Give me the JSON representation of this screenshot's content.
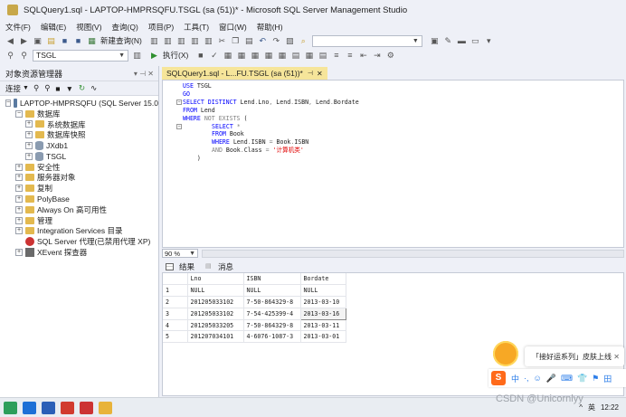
{
  "window": {
    "title": "SQLQuery1.sql - LAPTOP-HMPRSQFU.TSGL (sa (51))* - Microsoft SQL Server Management Studio"
  },
  "menu": [
    "文件(F)",
    "编辑(E)",
    "视图(V)",
    "查询(Q)",
    "项目(P)",
    "工具(T)",
    "窗口(W)",
    "帮助(H)"
  ],
  "toolbar": {
    "new_query": "新建查询(N)",
    "execute": "执行(X)",
    "database": "TSGL",
    "search_value": ""
  },
  "object_explorer": {
    "title": "对象资源管理器",
    "connect": "连接",
    "nodes": [
      {
        "label": "LAPTOP-HMPRSQFU (SQL Server 15.0",
        "depth": 0,
        "expand": "−",
        "icon": "server-icon"
      },
      {
        "label": "数据库",
        "depth": 1,
        "expand": "−",
        "icon": "folder-icon"
      },
      {
        "label": "系统数据库",
        "depth": 2,
        "expand": "+",
        "icon": "folder-icon"
      },
      {
        "label": "数据库快照",
        "depth": 2,
        "expand": "+",
        "icon": "folder-icon"
      },
      {
        "label": "JXdb1",
        "depth": 2,
        "expand": "+",
        "icon": "database-icon"
      },
      {
        "label": "TSGL",
        "depth": 2,
        "expand": "+",
        "icon": "database-icon"
      },
      {
        "label": "安全性",
        "depth": 1,
        "expand": "+",
        "icon": "folder-icon"
      },
      {
        "label": "服务器对象",
        "depth": 1,
        "expand": "+",
        "icon": "folder-icon"
      },
      {
        "label": "复制",
        "depth": 1,
        "expand": "+",
        "icon": "folder-icon"
      },
      {
        "label": "PolyBase",
        "depth": 1,
        "expand": "+",
        "icon": "folder-icon"
      },
      {
        "label": "Always On 高可用性",
        "depth": 1,
        "expand": "+",
        "icon": "folder-icon"
      },
      {
        "label": "管理",
        "depth": 1,
        "expand": "+",
        "icon": "folder-icon"
      },
      {
        "label": "Integration Services 目录",
        "depth": 1,
        "expand": "+",
        "icon": "folder-icon"
      },
      {
        "label": "SQL Server 代理(已禁用代理 XP)",
        "depth": 1,
        "expand": "",
        "icon": "agent-icon"
      },
      {
        "label": "XEvent 探查器",
        "depth": 1,
        "expand": "+",
        "icon": "xevent-icon"
      }
    ]
  },
  "editor": {
    "tab_label": "SQLQuery1.sql - L...FU.TSGL (sa (51))*",
    "zoom": "90 %",
    "lines": [
      {
        "indent": 0,
        "parts": [
          [
            "kw",
            "USE "
          ],
          [
            "blk",
            "TSGL"
          ]
        ]
      },
      {
        "indent": 0,
        "parts": [
          [
            "kw",
            "GO"
          ]
        ]
      },
      {
        "indent": 0,
        "parts": [
          [
            "kw",
            "SELECT DISTINCT "
          ],
          [
            "blk",
            "Lend"
          ],
          [
            "gray",
            "."
          ],
          [
            "blk",
            "Lno"
          ],
          [
            "gray",
            ","
          ],
          [
            "blk",
            " Lend"
          ],
          [
            "gray",
            "."
          ],
          [
            "blk",
            "ISBN"
          ],
          [
            "gray",
            ","
          ],
          [
            "blk",
            " Lend"
          ],
          [
            "gray",
            "."
          ],
          [
            "blk",
            "Bordate"
          ]
        ]
      },
      {
        "indent": 0,
        "parts": [
          [
            "kw",
            "FROM "
          ],
          [
            "blk",
            "Lend"
          ]
        ]
      },
      {
        "indent": 0,
        "parts": [
          [
            "kw",
            "WHERE "
          ],
          [
            "gray",
            "NOT EXISTS "
          ],
          [
            "blk",
            "("
          ]
        ]
      },
      {
        "indent": 1,
        "parts": [
          [
            "kw",
            "SELECT "
          ],
          [
            "gray",
            "*"
          ]
        ]
      },
      {
        "indent": 1,
        "parts": [
          [
            "kw",
            "FROM "
          ],
          [
            "blk",
            "Book"
          ]
        ]
      },
      {
        "indent": 1,
        "parts": [
          [
            "kw",
            "WHERE "
          ],
          [
            "blk",
            "Lend"
          ],
          [
            "gray",
            "."
          ],
          [
            "blk",
            "ISBN "
          ],
          [
            "gray",
            "= "
          ],
          [
            "blk",
            "Book"
          ],
          [
            "gray",
            "."
          ],
          [
            "blk",
            "ISBN"
          ]
        ]
      },
      {
        "indent": 1,
        "parts": [
          [
            "gray",
            "AND "
          ],
          [
            "blk",
            "Book"
          ],
          [
            "gray",
            "."
          ],
          [
            "blk",
            "Class "
          ],
          [
            "gray",
            "= "
          ],
          [
            "str",
            "'计算机类'"
          ]
        ]
      },
      {
        "indent": 0,
        "parts": [
          [
            "blk",
            "    )"
          ]
        ]
      }
    ]
  },
  "results": {
    "tab_results": "结果",
    "tab_messages": "消息",
    "columns": [
      "Lno",
      "ISBN",
      "Bordate"
    ],
    "rows": [
      [
        "1",
        "NULL",
        "NULL",
        "NULL"
      ],
      [
        "2",
        "201205033102",
        "7-50-864329-8",
        "2013-03-10"
      ],
      [
        "3",
        "201205033102",
        "7-54-425399-4",
        "2013-03-16"
      ],
      [
        "4",
        "201205033205",
        "7-50-864329-8",
        "2013-03-11"
      ],
      [
        "5",
        "201207034101",
        "4-6076-1087-3",
        "2013-03-01"
      ]
    ]
  },
  "ime": {
    "bubble_text": "「接好运系列」皮肤上线",
    "bar_items": [
      "中",
      "·,",
      "☺",
      "🎤",
      "⌨",
      "👕",
      "⚑",
      "田"
    ]
  },
  "taskbar": {
    "time": "12:22",
    "tray": [
      "^",
      "英"
    ],
    "watermark": "CSDN @Unicornlyy"
  },
  "colors": {
    "active_tab": "#f6e59a",
    "keyword": "#0000ff",
    "string": "#e00000",
    "operator": "#808080"
  }
}
